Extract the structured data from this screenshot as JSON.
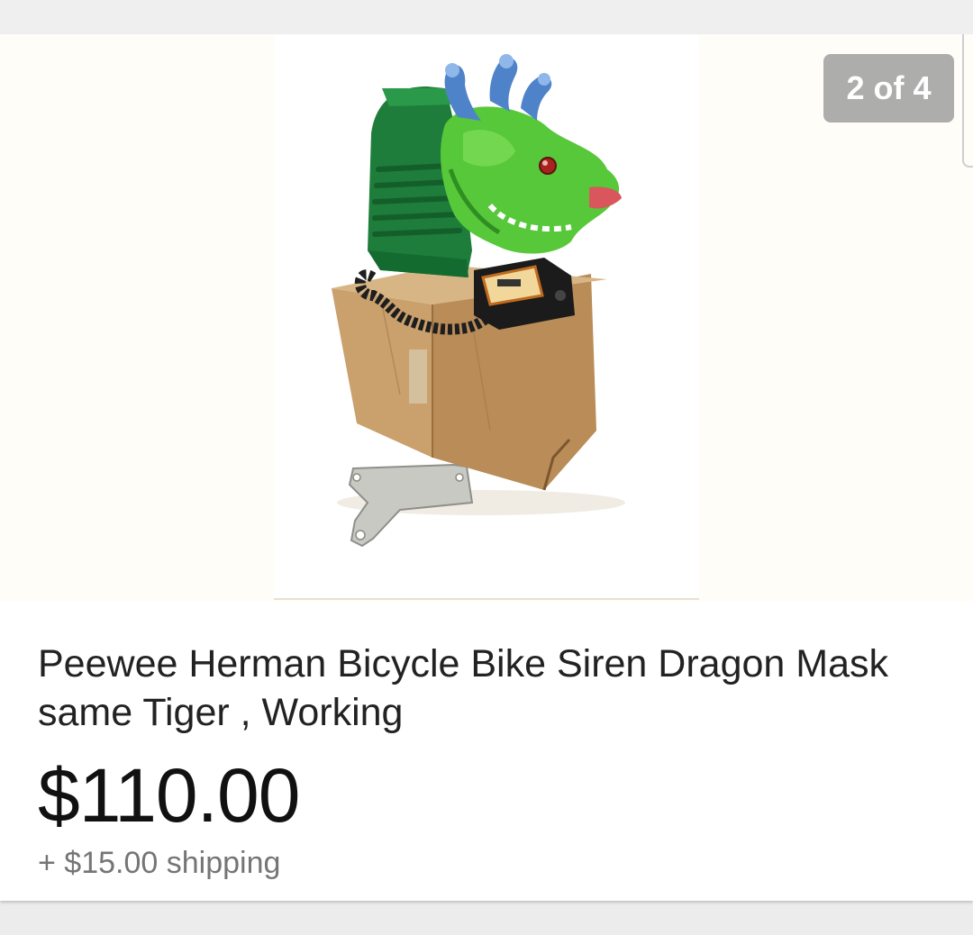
{
  "listing": {
    "image_counter": "2 of 4",
    "image_description": "Green dragon head bicycle siren on cardboard box with metal mounting bracket",
    "title": "Peewee Herman Bicycle Bike Siren Dragon Mask same Tiger , Working",
    "price": "$110.00",
    "shipping": "+ $15.00 shipping"
  }
}
